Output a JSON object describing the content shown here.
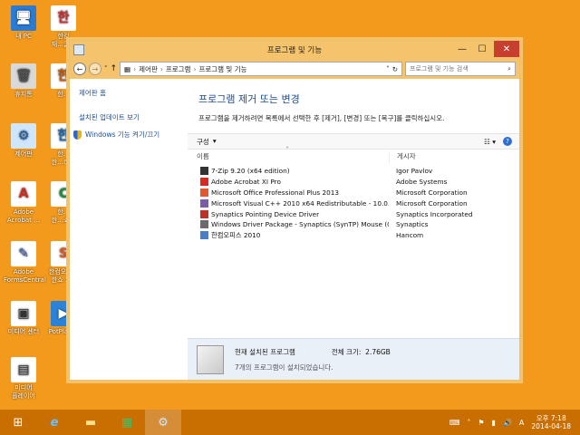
{
  "desktop": {
    "icons": [
      {
        "label": "내 PC"
      },
      {
        "label": "한컴\n재…글 9"
      },
      {
        "label": "휴지통"
      },
      {
        "label": "한…"
      },
      {
        "label": "제어판"
      },
      {
        "label": "한…\n한…리 9"
      },
      {
        "label": "Adobe\nAcrobat …"
      },
      {
        "label": "한…\n한…쇼 9"
      },
      {
        "label": "Adobe\nFormsCentral"
      },
      {
        "label": "한컴오피스\n한쇼 2…"
      },
      {
        "label": "미디어 센터"
      },
      {
        "label": "PotPlay…"
      },
      {
        "label": "미디어\n플레이어"
      }
    ]
  },
  "window": {
    "title": "프로그램 및 기능",
    "min": "—",
    "max": "☐",
    "close": "✕",
    "address": [
      "제어판",
      "프로그램",
      "프로그램 및 기능"
    ],
    "search_placeholder": "프로그램 및 기능 검색"
  },
  "left": {
    "home": "제어판 홈",
    "updates": "설치된 업데이트 보기",
    "features": "Windows 기능 켜기/끄기"
  },
  "main": {
    "heading": "프로그램 제거 또는 변경",
    "subtext": "프로그램을 제거하려면 목록에서 선택한 후 [제거], [변경] 또는 [복구]를 클릭하십시오.",
    "organize": "구성",
    "col_name": "이름",
    "col_publisher": "게시자"
  },
  "programs": [
    {
      "name": "7-Zip 9.20 (x64 edition)",
      "publisher": "Igor Pavlov",
      "color": "#333333"
    },
    {
      "name": "Adobe Acrobat XI Pro",
      "publisher": "Adobe Systems",
      "color": "#d42b1e"
    },
    {
      "name": "Microsoft Office Professional Plus 2013",
      "publisher": "Microsoft Corporation",
      "color": "#e4572e"
    },
    {
      "name": "Microsoft Visual C++ 2010  x64 Redistributable - 10.0.4...",
      "publisher": "Microsoft Corporation",
      "color": "#7a5ca8"
    },
    {
      "name": "Synaptics Pointing Device Driver",
      "publisher": "Synaptics Incorporated",
      "color": "#c0302a"
    },
    {
      "name": "Windows Driver Package - Synaptics (SynTP) Mouse  (0...",
      "publisher": "Synaptics",
      "color": "#6b6b6b"
    },
    {
      "name": "한컴오피스 2010",
      "publisher": "Hancom",
      "color": "#4a7fc8"
    }
  ],
  "footer": {
    "label": "현재 설치된 프로그램",
    "size_label": "전체 크기:",
    "size_value": "2.76GB",
    "count": "7개의 프로그램이 설치되었습니다."
  },
  "taskbar": {
    "time": "오후 7:18",
    "date": "2014-04-18",
    "lang": "A"
  }
}
